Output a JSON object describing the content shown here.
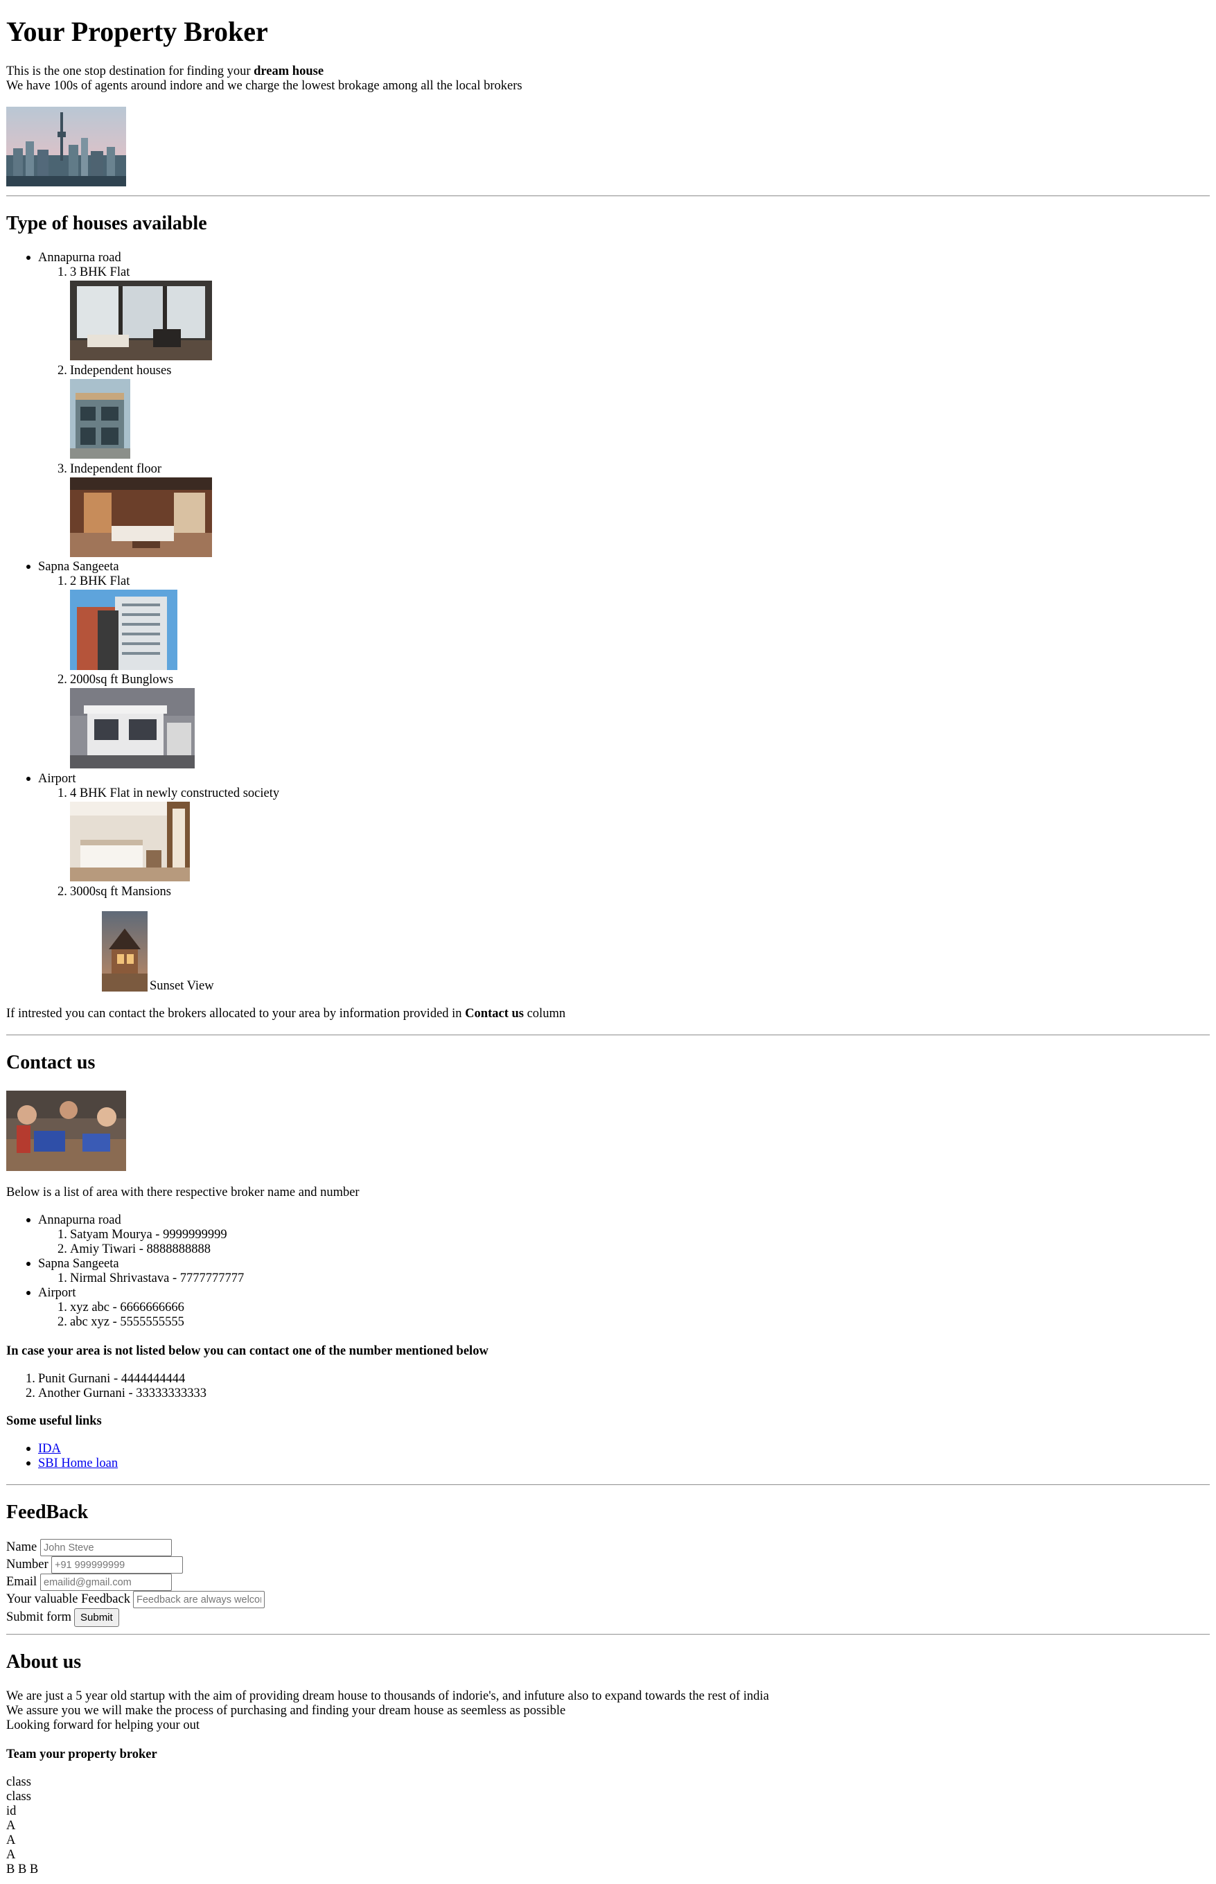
{
  "header": {
    "title": "Your Property Broker",
    "intro_prefix": "This is the one stop destination for finding your",
    "intro_bold": "dream house",
    "intro_line2": "We have 100s of agents around indore and we charge the lowest brokage among all the local brokers"
  },
  "houses": {
    "heading": "Type of houses available",
    "areas": [
      {
        "name": "Annapurna road",
        "items": [
          "3 BHK Flat",
          "Independent houses",
          "Independent floor"
        ]
      },
      {
        "name": "Sapna Sangeeta",
        "items": [
          "2 BHK Flat",
          "2000sq ft Bunglows"
        ]
      },
      {
        "name": "Airport",
        "items": [
          "4 BHK Flat in newly constructed society",
          "3000sq ft Mansions"
        ]
      }
    ],
    "numbers": [
      "1.",
      "2.",
      "3."
    ],
    "caption": "Sunset View",
    "footer_prefix": "If intrested you can contact the brokers allocated to your area by information provided in",
    "footer_bold": "Contact us",
    "footer_suffix": "column"
  },
  "contact": {
    "heading": "Contact us",
    "intro": "Below is a list of area with there respective broker name and number",
    "areas": [
      {
        "name": "Annapurna road",
        "brokers": [
          "Satyam Mourya - 9999999999",
          "Amiy Tiwari - 8888888888"
        ]
      },
      {
        "name": "Sapna Sangeeta",
        "brokers": [
          "Nirmal Shrivastava - 7777777777"
        ]
      },
      {
        "name": "Airport",
        "brokers": [
          "xyz abc - 6666666666",
          "abc xyz - 5555555555"
        ]
      }
    ],
    "fallback_heading": "In case your area is not listed below you can contact one of the number mentioned below",
    "fallback": [
      "Punit Gurnani - 4444444444",
      "Another Gurnani - 33333333333"
    ],
    "links_heading": "Some useful links",
    "links": [
      "IDA",
      "SBI Home loan"
    ]
  },
  "feedback": {
    "heading": "FeedBack",
    "name_label": "Name",
    "name_placeholder": "John Steve",
    "number_label": "Number",
    "number_placeholder": "+91 999999999",
    "email_label": "Email",
    "email_placeholder": "emailid@gmail.com",
    "feedback_label": "Your valuable Feedback",
    "feedback_placeholder": "Feedback are always welcome",
    "submit_label": "Submit form",
    "submit_button": "Submit"
  },
  "about": {
    "heading": "About us",
    "lines": [
      "We are just a 5 year old startup with the aim of providing dream house to thousands of indorie's, and infuture also to expand towards the rest of india",
      "We assure you we will make the process of purchasing and finding your dream house as seemless as possible",
      "Looking forward for helping your out"
    ],
    "team_heading": "Team your property broker",
    "tail": [
      "class",
      "class",
      "id",
      "A",
      "A",
      "A",
      "B B B"
    ]
  }
}
